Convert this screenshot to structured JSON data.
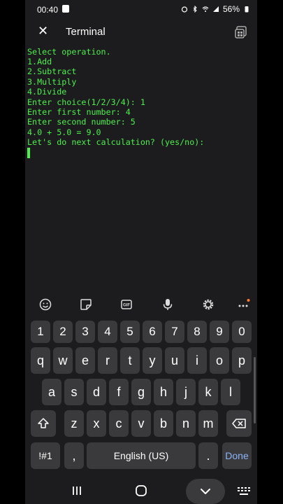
{
  "status": {
    "time": "00:40",
    "battery": "56%"
  },
  "appbar": {
    "close_icon": "close-icon",
    "title": "Terminal",
    "window_icon": "windows-icon"
  },
  "terminal": {
    "lines": [
      "Select operation.",
      "1.Add",
      "2.Subtract",
      "3.Multiply",
      "4.Divide",
      "Enter choice(1/2/3/4): 1",
      "Enter first number: 4",
      "Enter second number: 5",
      "4.0 + 5.0 = 9.0",
      "Let's do next calculation? (yes/no):"
    ],
    "text_color": "#4cf04c"
  },
  "keyboard": {
    "toolbar_icons": [
      "emoji-icon",
      "sticker-icon",
      "gif-icon",
      "microphone-icon",
      "settings-icon",
      "more-icon"
    ],
    "row_numbers": [
      "1",
      "2",
      "3",
      "4",
      "5",
      "6",
      "7",
      "8",
      "9",
      "0"
    ],
    "row_top": [
      "q",
      "w",
      "e",
      "r",
      "t",
      "y",
      "u",
      "i",
      "o",
      "p"
    ],
    "row_middle": [
      "a",
      "s",
      "d",
      "f",
      "g",
      "h",
      "j",
      "k",
      "l"
    ],
    "row_bottom": [
      "z",
      "x",
      "c",
      "v",
      "b",
      "n",
      "m"
    ],
    "symbols_label": "!#1",
    "comma_label": ",",
    "space_label": "English (US)",
    "period_label": ".",
    "done_label": "Done",
    "accent_color": "#8ab4f8"
  },
  "nav": {
    "icons": [
      "recents-icon",
      "home-icon",
      "collapse-keyboard-icon",
      "keyboard-switch-icon"
    ]
  }
}
